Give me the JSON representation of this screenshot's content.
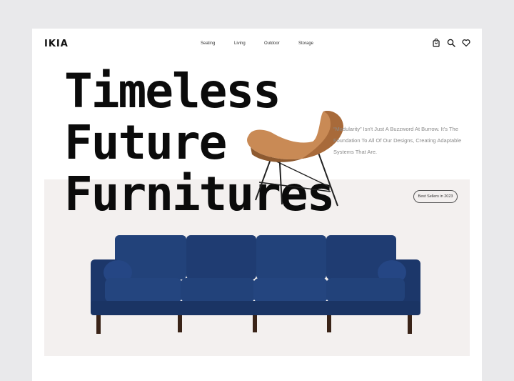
{
  "brand": {
    "logo": "IKIA"
  },
  "nav": {
    "items": [
      "Seating",
      "Living",
      "Outdoor",
      "Storage"
    ]
  },
  "header_icons": [
    "shopping-bag-icon",
    "search-icon",
    "heart-icon"
  ],
  "hero": {
    "headline_lines": [
      "Timeless",
      "Future",
      "Furnitures"
    ],
    "description": "“Modularity” Isn't Just A Buzzword At Burrow. It's The Foundation To All Of Our Designs, Creating Adaptable Systems That Are.",
    "badge": "Best Sellers in 2023"
  },
  "colors": {
    "page_bg": "#ffffff",
    "hero_bg": "#f3f0ef",
    "sofa": "#1f3a6b",
    "chair": "#c98a55",
    "text": "#0b0b0b"
  }
}
